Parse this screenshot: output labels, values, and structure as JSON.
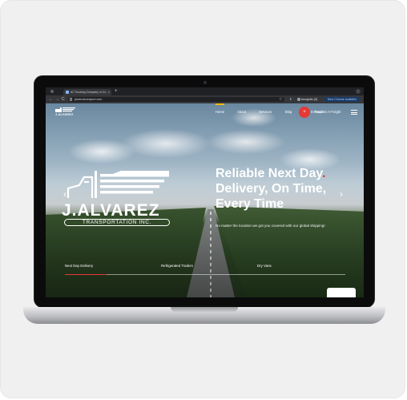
{
  "browser": {
    "tab_title": "#1 Trucking Company in Co",
    "tab_close": "×",
    "new_tab": "+",
    "url": "jalvareztransport.com",
    "back": "←",
    "forward": "→",
    "reload": "C",
    "star": "☆",
    "download": "⭳",
    "incognito_label": "Incognito (3)",
    "update_label": "New Chrome available",
    "menu": "⋮"
  },
  "site": {
    "logo_small": "J.ALVAREZ",
    "nav": [
      {
        "label": "Home"
      },
      {
        "label": "About"
      },
      {
        "label": "Services"
      },
      {
        "label": "Blog"
      },
      {
        "label": "Get In Touch"
      }
    ],
    "cta_icon": "+",
    "cta_label": "Request A Freight",
    "brand": "J.ALVAREZ",
    "tagline": "TRANSPORTATION INC.",
    "headline_1": "Reliable Next Day",
    "headline_dot": ".",
    "headline_2": "Delivery, On Time,",
    "headline_3": "Every Time",
    "subline": "No matter the location we got you covered with our global shipping!",
    "arrow_left": "‹",
    "arrow_right": "›",
    "service_tabs": [
      {
        "label": "Next Day Delivery"
      },
      {
        "label": "Refrigerated Trailers"
      },
      {
        "label": "Dry Vans"
      }
    ]
  },
  "colors": {
    "accent_red": "#e53935",
    "nav_active": "#f0b90b",
    "chrome_dark": "#202124"
  }
}
